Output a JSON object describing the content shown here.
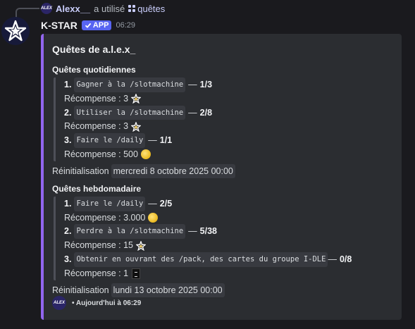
{
  "reply": {
    "avatar_text": "ALEX",
    "username": "Alexx__",
    "action": "a utilisé",
    "command": "quêtes"
  },
  "message": {
    "bot_name": "K-STAR",
    "badge": "APP",
    "time": "06:29"
  },
  "embed": {
    "accent_color": "#9266ee",
    "title": "Quêtes de a.l.e.x_",
    "daily": {
      "title": "Quêtes quotidiennes",
      "quests": [
        {
          "num": "1.",
          "task": "Gagner à la /slotmachine",
          "sep": "—",
          "progress": "1/3",
          "reward_label": "Récompense : 3",
          "reward_icon": "star-icon"
        },
        {
          "num": "2.",
          "task": "Utiliser la /slotmachine",
          "sep": "—",
          "progress": "2/8",
          "reward_label": "Récompense : 3",
          "reward_icon": "star-icon"
        },
        {
          "num": "3.",
          "task": "Faire le /daily",
          "sep": "—",
          "progress": "1/1",
          "reward_label": "Récompense : 500",
          "reward_icon": "coin-icon"
        }
      ],
      "reset_label": "Réinitialisation",
      "reset_date": "mercredi 8 octobre 2025 00:00"
    },
    "weekly": {
      "title": "Quêtes hebdomadaire",
      "quests": [
        {
          "num": "1.",
          "task": "Faire le /daily",
          "sep": "—",
          "progress": "2/5",
          "reward_label": "Récompense : 3.000",
          "reward_icon": "coin-icon"
        },
        {
          "num": "2.",
          "task": "Perdre à la /slotmachine",
          "sep": "—",
          "progress": "5/38",
          "reward_label": "Récompense : 15",
          "reward_icon": "star-icon"
        },
        {
          "num": "3.",
          "task": "Obtenir en ouvrant des /pack, des cartes du groupe I-DLE",
          "sep": "—",
          "progress": "0/8",
          "reward_label": "Récompense : 1",
          "reward_icon": "card-icon"
        }
      ],
      "reset_label": "Réinitialisation",
      "reset_date": "lundi 13 octobre 2025 00:00"
    },
    "footer": {
      "avatar_text": "ALEX",
      "text": "• Aujourd'hui à 06:29"
    }
  }
}
